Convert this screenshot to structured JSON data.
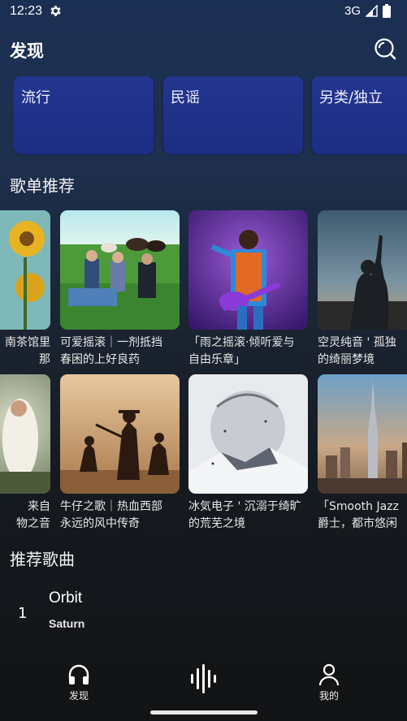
{
  "status_bar": {
    "time": "12:23",
    "network": "3G"
  },
  "header": {
    "title": "发现"
  },
  "genres": [
    {
      "label": "流行"
    },
    {
      "label": "民谣"
    },
    {
      "label": "另类/独立"
    }
  ],
  "sections": {
    "playlists_title": "歌单推荐",
    "songs_title": "推荐歌曲"
  },
  "playlists": [
    {
      "title": "南茶馆里\n那"
    },
    {
      "title": "可爱摇滚｜一剂抵挡\n春困的上好良药"
    },
    {
      "title": "「雨之摇滚·倾听爱与\n自由乐章」"
    },
    {
      "title": "空灵纯音 ' 孤独\n的绮丽梦境"
    },
    {
      "title": "来自\n物之音"
    },
    {
      "title": "牛仔之歌｜热血西部\n永远的风中传奇"
    },
    {
      "title": "冰気电子 ' 沉溺于绮旷\n的荒芜之境"
    },
    {
      "title": "「Smooth Jazz\n爵士，都市悠闲"
    }
  ],
  "songs": [
    {
      "rank": "1",
      "title": "Orbit",
      "artist": "Saturn"
    }
  ],
  "bottom_nav": [
    {
      "label": "发现",
      "icon": "headphones-icon"
    },
    {
      "label": "",
      "icon": "waveform-icon"
    },
    {
      "label": "我的",
      "icon": "person-icon"
    }
  ],
  "colors": {
    "genre_card": "#23358f",
    "background_top": "#1b2f52",
    "background_bottom": "#131416"
  }
}
